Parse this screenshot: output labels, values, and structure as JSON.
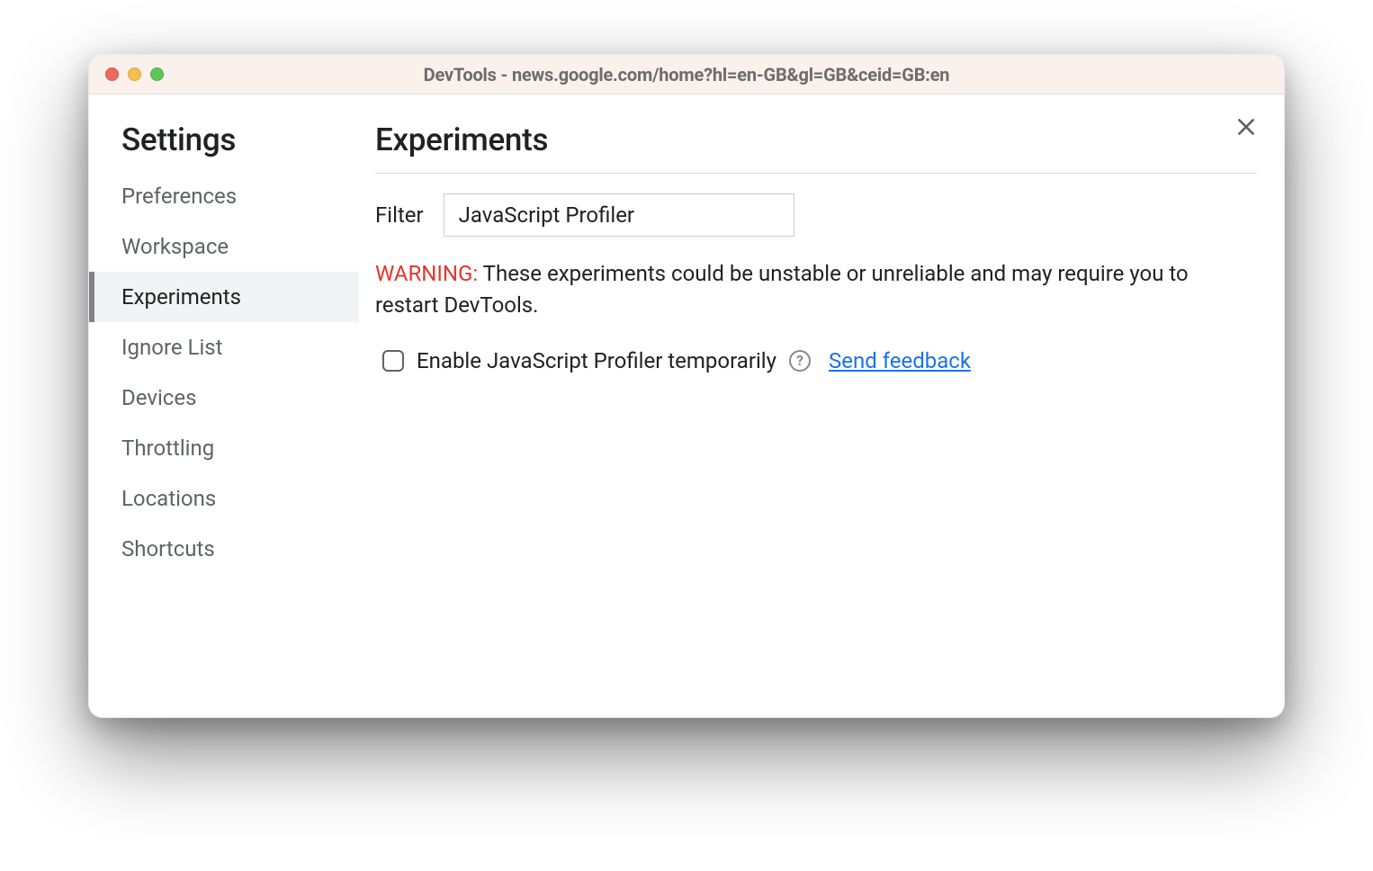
{
  "window": {
    "title": "DevTools - news.google.com/home?hl=en-GB&gl=GB&ceid=GB:en"
  },
  "sidebar": {
    "title": "Settings",
    "items": [
      {
        "label": "Preferences",
        "selected": false
      },
      {
        "label": "Workspace",
        "selected": false
      },
      {
        "label": "Experiments",
        "selected": true
      },
      {
        "label": "Ignore List",
        "selected": false
      },
      {
        "label": "Devices",
        "selected": false
      },
      {
        "label": "Throttling",
        "selected": false
      },
      {
        "label": "Locations",
        "selected": false
      },
      {
        "label": "Shortcuts",
        "selected": false
      }
    ]
  },
  "main": {
    "title": "Experiments",
    "filter_label": "Filter",
    "filter_value": "JavaScript Profiler",
    "warning_prefix": "WARNING:",
    "warning_body": "These experiments could be unstable or unreliable and may require you to restart DevTools.",
    "experiment": {
      "checked": false,
      "label": "Enable JavaScript Profiler temporarily",
      "help_glyph": "?",
      "feedback_text": "Send feedback"
    }
  }
}
